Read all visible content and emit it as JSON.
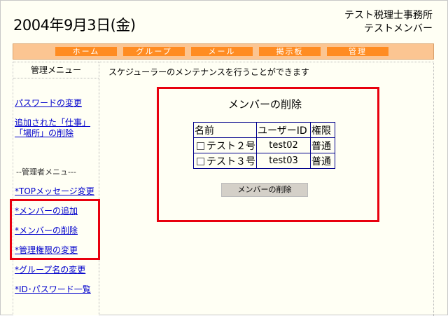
{
  "header": {
    "date": "2004年9月3日(金)",
    "office_line1": "テスト税理士事務所",
    "office_line2": "テストメンバー"
  },
  "nav": {
    "items": [
      "ホーム",
      "グループ",
      "メール",
      "掲示板",
      "管理"
    ]
  },
  "sidebar": {
    "title": "管理メニュー",
    "links": [
      "パスワードの変更",
      "追加された「仕事」",
      "「場所」の削除"
    ],
    "admin_section": "--管理者メニュ---",
    "admin_links": [
      "*TOPメッセージ変更",
      "*メンバーの追加",
      "*メンバーの削除",
      "*管理権限の変更",
      "*グループ名の変更",
      "*ID･パスワード一覧"
    ]
  },
  "main": {
    "description": "スケジューラーのメンテナンスを行うことができます",
    "form_title": "メンバーの削除",
    "table": {
      "headers": [
        "名前",
        "ユーザーID",
        "権限"
      ],
      "rows": [
        {
          "name": "テスト２号",
          "user_id": "test02",
          "role": "普通"
        },
        {
          "name": "テスト３号",
          "user_id": "test03",
          "role": "普通"
        }
      ]
    },
    "delete_button": "メンバーの削除"
  },
  "colors": {
    "nav_bar": "#fbc592",
    "nav_button": "#ff8c22",
    "link": "#0000cc",
    "highlight": "#e8000e",
    "table_border": "#00008b"
  }
}
